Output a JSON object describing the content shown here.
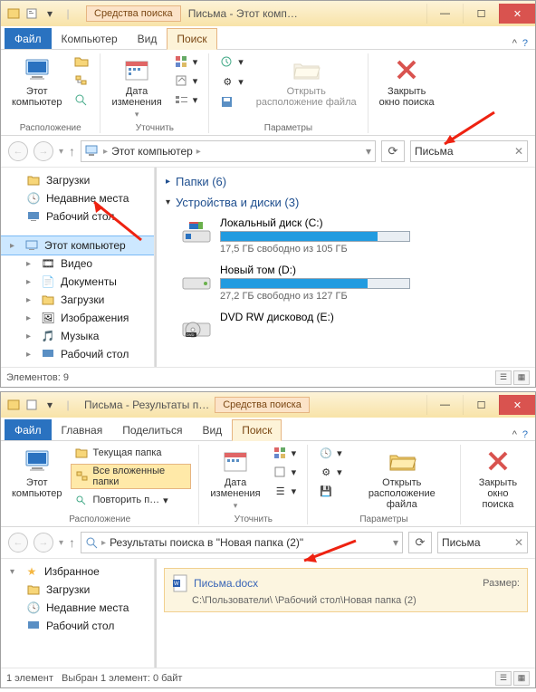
{
  "w1": {
    "tool_tab": "Средства поиска",
    "title": "Письма - Этот комп…",
    "tabs": {
      "file": "Файл",
      "computer": "Компьютер",
      "view": "Вид",
      "search": "Поиск"
    },
    "ribbon": {
      "this_pc": "Этот\nкомпьютер",
      "date": "Дата\nизменения",
      "open_loc": "Открыть\nрасположение файла",
      "close_search": "Закрыть\nокно поиска",
      "g_location": "Расположение",
      "g_refine": "Уточнить",
      "g_params": "Параметры"
    },
    "addr": {
      "crumb": "Этот компьютер"
    },
    "search": {
      "value": "Письма"
    },
    "sidebar": {
      "downloads": "Загрузки",
      "recent": "Недавние места",
      "desktop": "Рабочий стол",
      "this_pc": "Этот компьютер",
      "videos": "Видео",
      "documents": "Документы",
      "downloads2": "Загрузки",
      "pictures": "Изображения",
      "music": "Музыка",
      "desktop2": "Рабочий стол"
    },
    "main": {
      "folders_hdr": "Папки (6)",
      "devices_hdr": "Устройства и диски (3)",
      "disk_c": {
        "name": "Локальный диск (C:)",
        "sub": "17,5 ГБ свободно из 105 ГБ",
        "fill": 83
      },
      "disk_d": {
        "name": "Новый том (D:)",
        "sub": "27,2 ГБ свободно из 127 ГБ",
        "fill": 78
      },
      "dvd": {
        "name": "DVD RW дисковод (E:)"
      }
    },
    "status": "Элементов: 9"
  },
  "w2": {
    "title": "Письма - Результаты п…",
    "tool_tab": "Средства поиска",
    "tabs": {
      "file": "Файл",
      "main": "Главная",
      "share": "Поделиться",
      "view": "Вид",
      "search": "Поиск"
    },
    "ribbon": {
      "this_pc": "Этот\nкомпьютер",
      "cur_folder": "Текущая папка",
      "all_sub": "Все вложенные папки",
      "repeat": "Повторить п…",
      "date": "Дата\nизменения",
      "open_loc": "Открыть\nрасположение файла",
      "close_search": "Закрыть\nокно поиска",
      "g_location": "Расположение",
      "g_refine": "Уточнить",
      "g_params": "Параметры"
    },
    "addr": {
      "crumb": "Результаты поиска в \"Новая папка (2)\""
    },
    "search": {
      "value": "Письма"
    },
    "sidebar": {
      "fav": "Избранное",
      "downloads": "Загрузки",
      "recent": "Недавние места",
      "desktop": "Рабочий стол"
    },
    "file": {
      "name": "Письма.docx",
      "size_lbl": "Размер:",
      "path": "C:\\Пользователи\\               \\Рабочий стол\\Новая папка (2)"
    },
    "status": {
      "left": "1 элемент",
      "right": "Выбран 1 элемент: 0 байт"
    }
  }
}
